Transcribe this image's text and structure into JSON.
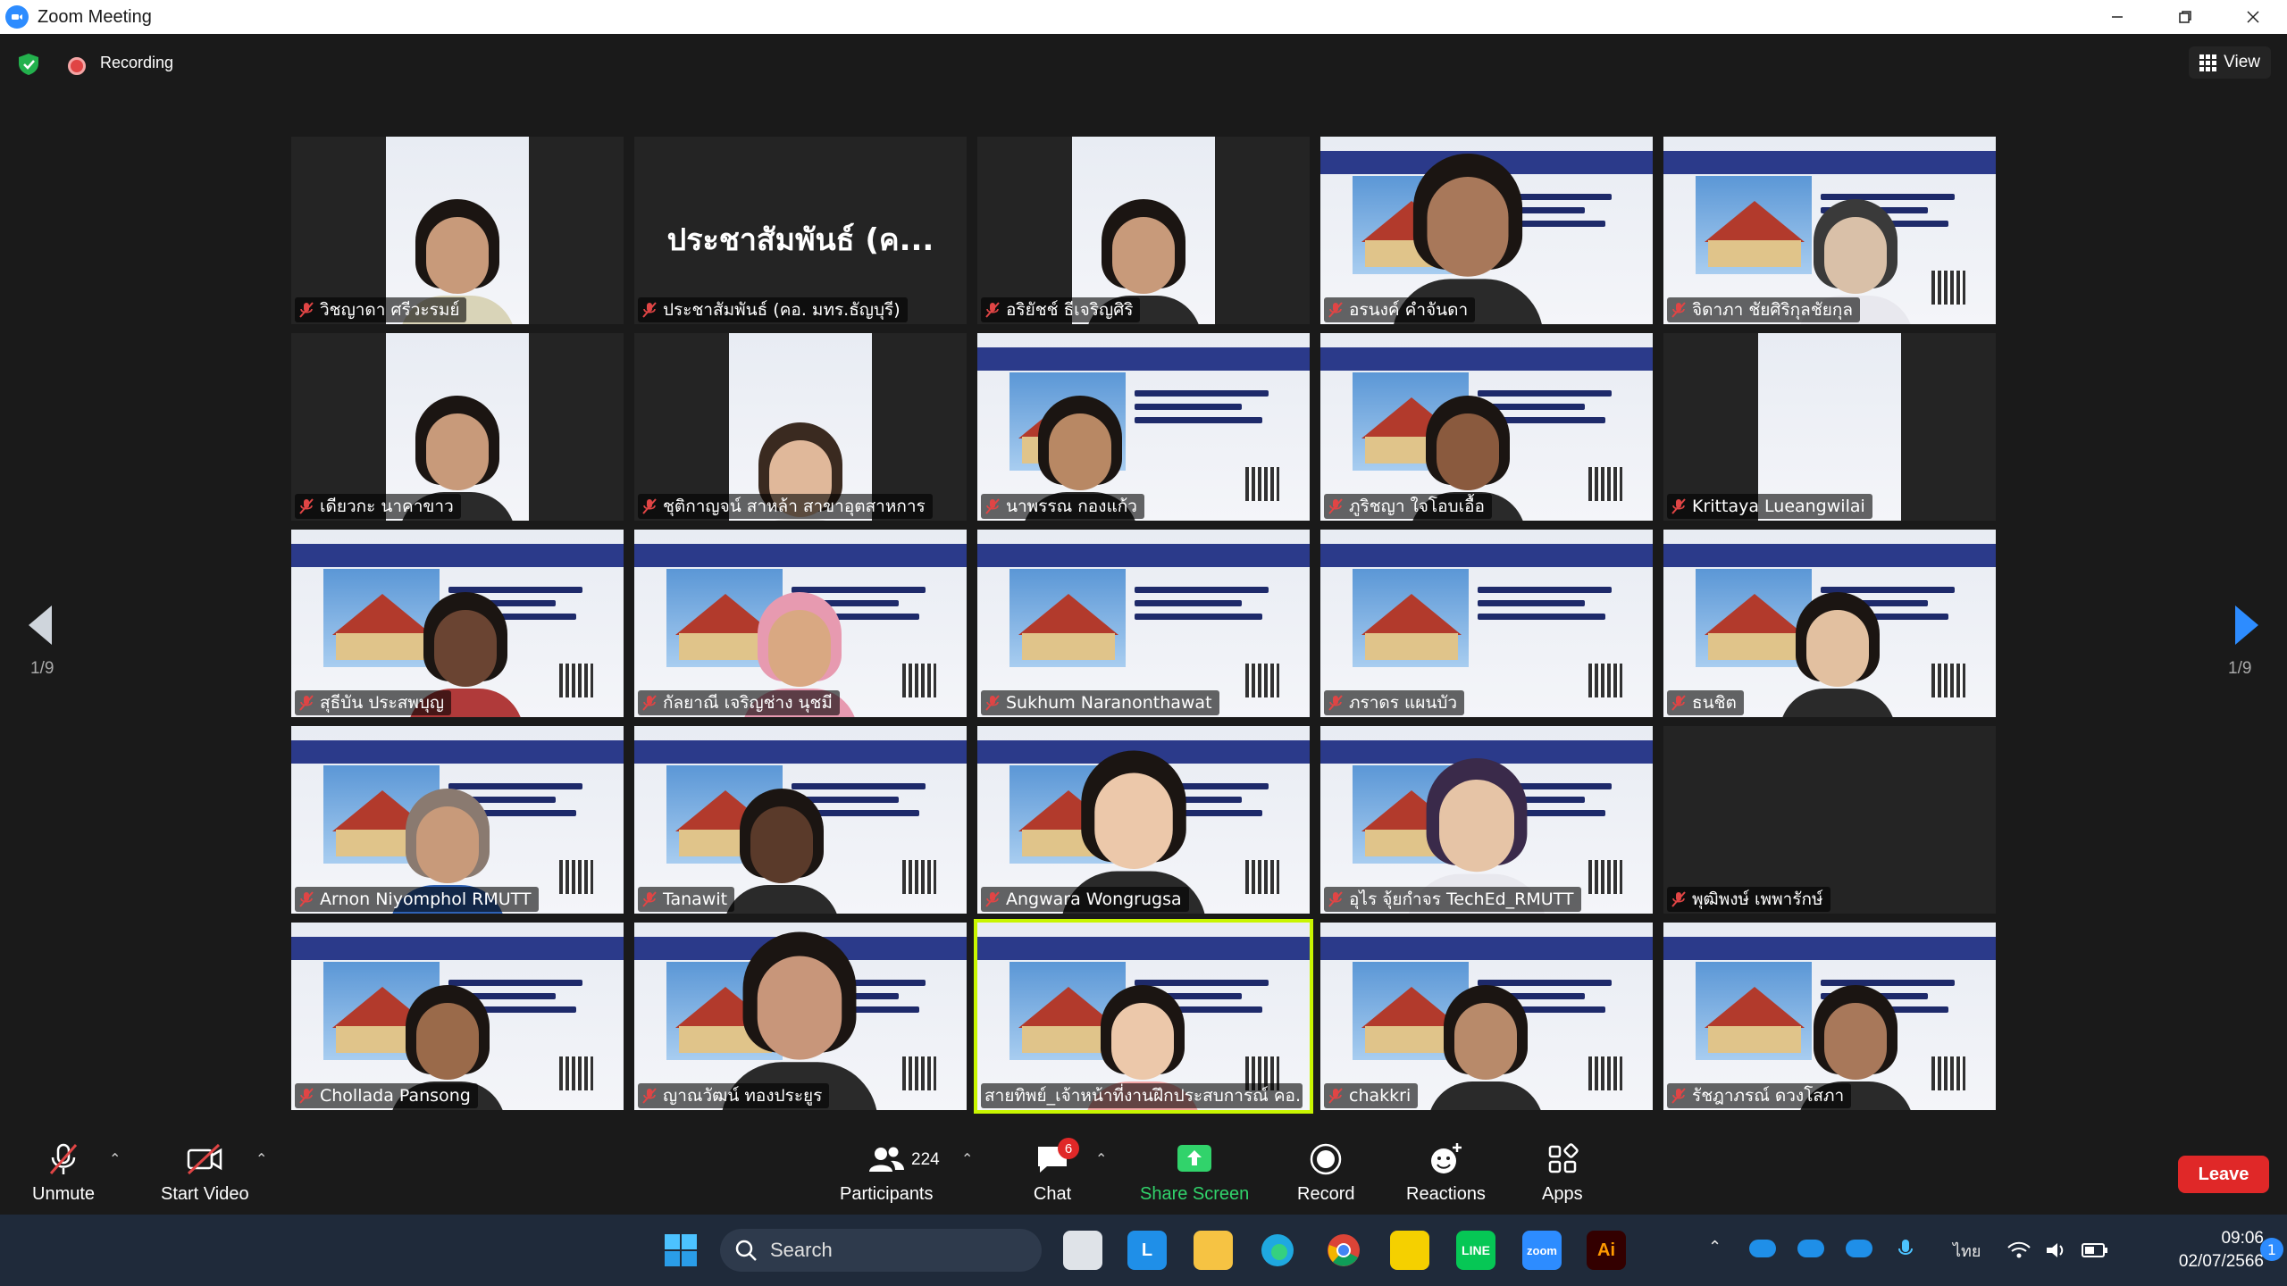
{
  "window": {
    "title": "Zoom Meeting"
  },
  "meeting": {
    "recording_label": "Recording",
    "view_label": "View",
    "page_left": "1/9",
    "page_right": "1/9"
  },
  "participants": [
    "วิชญาดา ศรีวะรมย์",
    "ประชาสัมพันธ์ (คอ. มทร.ธัญบุรี)",
    "อริยัชช์ ธีเจริญศิริ",
    "อรนงค์ คำจันดา",
    "จิดาภา ชัยศิริกุลชัยกุล",
    "เดียวกะ นาคาขาว",
    "ชุติกาญจน์ สาหล้า สาขาอุตสาหการ",
    "นาพรรณ กองแก้ว",
    "ภูริชญา ใจโอบเอื้อ",
    "Krittaya Lueangwilai",
    "สุธีบัน ประสพบุญ",
    "กัลยาณี เจริญช่าง นุชมี",
    "Sukhum Naranonthawat",
    "ภราดร แผนบัว",
    "ธนชิต",
    "Arnon Niyomphol RMUTT",
    "Tanawit",
    "Angwara Wongrugsa",
    "อุไร จุ้ยกำจร TechEd_RMUTT",
    "พุฒิพงษ์ เพพารักษ์",
    "Chollada Pansong",
    "ญาณวัฒน์ ทองประยูร",
    "สายทิพย์_เจ้าหน้าที่งานฝึกประสบการณ์ คอ.",
    "chakkri",
    "รัชฎาภรณ์ ดวงโสภา"
  ],
  "tile_overlay_text": "ประชาสัมพันธ์ (ค...",
  "controls": {
    "unmute": "Unmute",
    "start_video": "Start Video",
    "participants": "Participants",
    "participants_count": "224",
    "chat": "Chat",
    "chat_badge": "6",
    "share_screen": "Share Screen",
    "record": "Record",
    "reactions": "Reactions",
    "apps": "Apps",
    "leave": "Leave"
  },
  "taskbar": {
    "search_label": "Search",
    "language": "ไทย",
    "time": "09:06",
    "date": "02/07/2566",
    "notification_count": "1"
  },
  "colors": {
    "active_speaker": "#c8f500",
    "leave": "#e02828",
    "share": "#31d36b",
    "zoom_blue": "#2d8cff"
  }
}
